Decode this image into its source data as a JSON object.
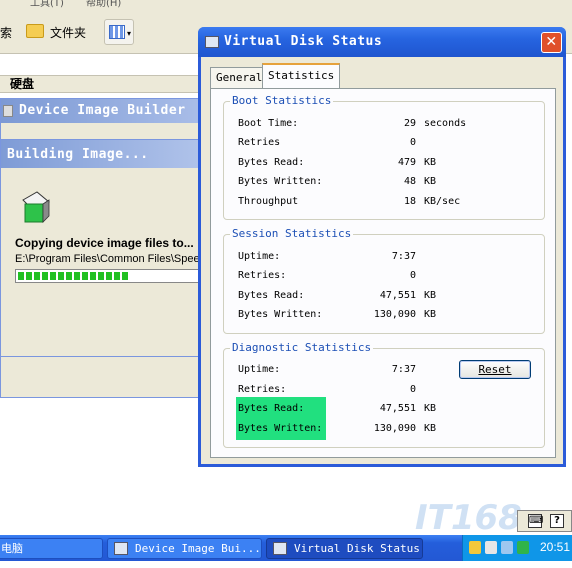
{
  "explorer": {
    "menu_tools": "工具(T)",
    "menu_help": "帮助(H)",
    "toolbar_search": "索",
    "toolbar_folders": "文件夹",
    "disk_header": "硬盘"
  },
  "device_image_builder": {
    "title": "Device Image Builder"
  },
  "building_dialog": {
    "title": "Building Image...",
    "message": "Copying device image files to...",
    "path": "E:\\Program Files\\Common Files\\Speec",
    "progress_fraction": 0.6
  },
  "vds": {
    "title": "Virtual Disk Status",
    "close_glyph": "✕",
    "tabs": [
      "General",
      "Statistics"
    ],
    "boot": {
      "label": "Boot Statistics",
      "rows": [
        {
          "label": "Boot Time:",
          "value": "29",
          "unit": "seconds"
        },
        {
          "label": "Retries",
          "value": "0",
          "unit": ""
        },
        {
          "label": "Bytes Read:",
          "value": "479",
          "unit": "KB"
        },
        {
          "label": "Bytes Written:",
          "value": "48",
          "unit": "KB"
        },
        {
          "label": "Throughput",
          "value": "18",
          "unit": "KB/sec"
        }
      ]
    },
    "session": {
      "label": "Session Statistics",
      "rows": [
        {
          "label": "Uptime:",
          "value": "7:37",
          "unit": ""
        },
        {
          "label": "Retries:",
          "value": "0",
          "unit": ""
        },
        {
          "label": "Bytes Read:",
          "value": "47,551",
          "unit": "KB"
        },
        {
          "label": "Bytes Written:",
          "value": "130,090",
          "unit": "KB"
        }
      ]
    },
    "diagnostic": {
      "label": "Diagnostic Statistics",
      "reset_label": "Reset",
      "rows": [
        {
          "label": "Uptime:",
          "value": "7:37",
          "unit": ""
        },
        {
          "label": "Retries:",
          "value": "0",
          "unit": ""
        },
        {
          "label": "Bytes Read:",
          "value": "47,551",
          "unit": "KB"
        },
        {
          "label": "Bytes Written:",
          "value": "130,090",
          "unit": "KB"
        }
      ],
      "highlight_color": "#21e07f"
    }
  },
  "taskbar": {
    "items": [
      {
        "label": "电脑"
      },
      {
        "label": "Device Image Bui..."
      },
      {
        "label": "Virtual Disk Status"
      }
    ],
    "clock": "20:51"
  },
  "watermark": "IT168",
  "colors": {
    "title_blue": "#2664e0",
    "group_label": "#1c4fb5",
    "progress_green": "#22c022"
  }
}
